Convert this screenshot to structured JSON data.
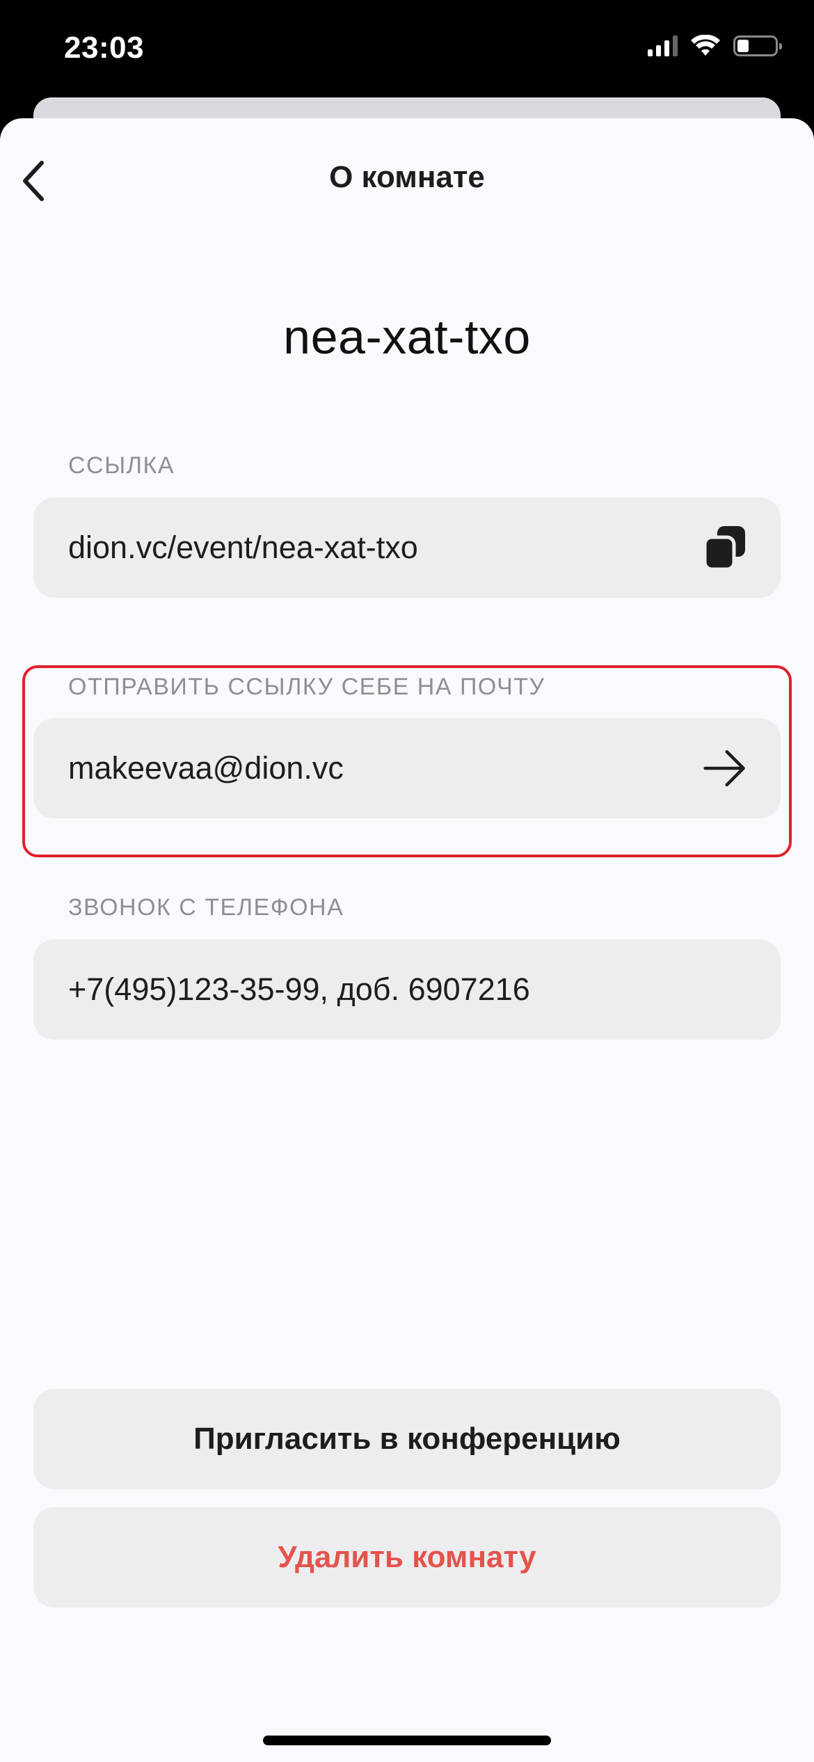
{
  "status_bar": {
    "time": "23:03",
    "icons": [
      "signal-icon",
      "wifi-icon",
      "battery-icon"
    ],
    "battery_level": 0.3
  },
  "nav": {
    "title": "О комнате",
    "back_icon": "chevron-left-icon"
  },
  "room": {
    "name": "nea-xat-txo"
  },
  "link_section": {
    "label": "ССЫЛКА",
    "value": "dion.vc/event/nea-xat-txo",
    "icon": "copy-icon"
  },
  "email_section": {
    "label": "ОТПРАВИТЬ ССЫЛКУ СЕБЕ НА ПОЧТУ",
    "value": "makeevaa@dion.vc",
    "icon": "arrow-right-icon"
  },
  "phone_section": {
    "label": "ЗВОНОК С ТЕЛЕФОНА",
    "value": "+7(495)123-35-99, доб. 6907216"
  },
  "actions": {
    "invite_label": "Пригласить в конференцию",
    "delete_label": "Удалить комнату"
  },
  "colors": {
    "highlight": "#e0202a",
    "danger": "#e5534b",
    "field_bg": "#ededf0",
    "sheet_bg": "#f9fafd"
  }
}
